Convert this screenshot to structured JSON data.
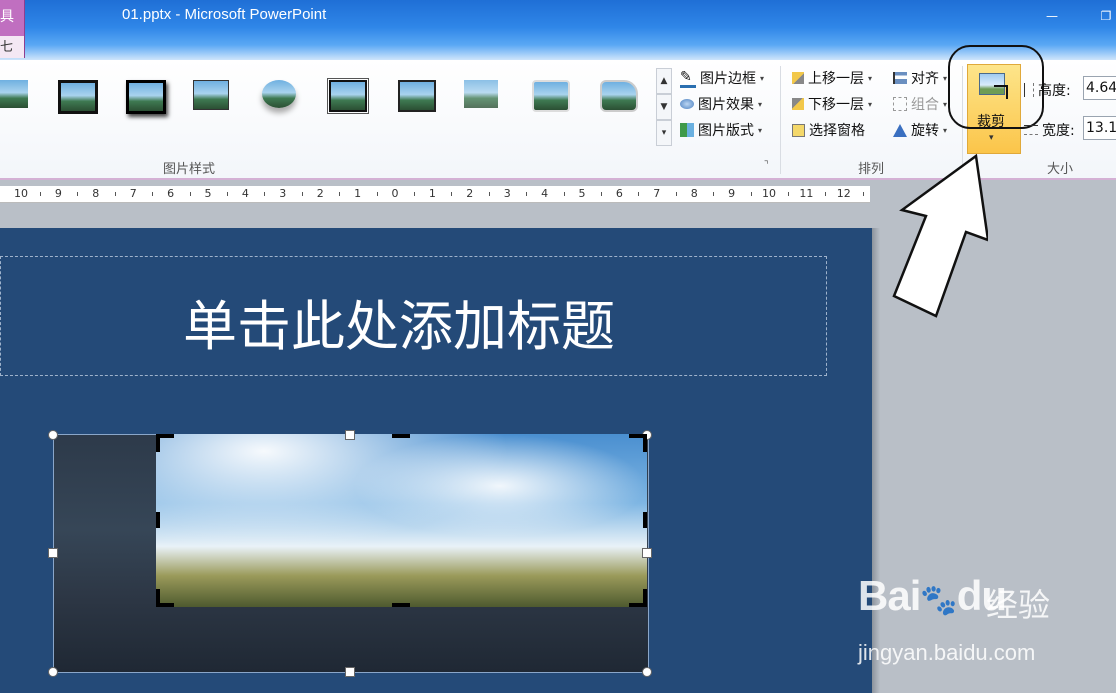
{
  "window": {
    "title": "01.pptx - Microsoft PowerPoint",
    "tool_tab_top": "具",
    "tool_tab_bottom": "七",
    "minimize": "—",
    "restore": "❐"
  },
  "ribbon": {
    "picture_styles_label": "图片样式",
    "picture_border": "图片边框",
    "picture_effects": "图片效果",
    "picture_layout": "图片版式",
    "arrange_label": "排列",
    "bring_forward": "上移一层",
    "send_backward": "下移一层",
    "selection_pane": "选择窗格",
    "align": "对齐",
    "group": "组合",
    "rotate": "旋转",
    "crop": "裁剪",
    "size_label": "大小",
    "height_label": "高度:",
    "height_value": "4.64",
    "width_label": "宽度:",
    "width_value": "13.1"
  },
  "ruler": {
    "numbers": [
      "10",
      "9",
      "8",
      "7",
      "6",
      "5",
      "4",
      "3",
      "2",
      "1",
      "0",
      "1",
      "2",
      "3",
      "4",
      "5",
      "6",
      "7",
      "8",
      "9",
      "10",
      "11",
      "12"
    ]
  },
  "slide": {
    "title": "单击此处添加标题"
  },
  "watermark": {
    "brand": "Bai",
    "brand2": "du",
    "cn": "经验",
    "url": "jingyan.baidu.com"
  },
  "colors": {
    "slide_bg": "#244a78",
    "accent": "#fbc54a",
    "tool_tab": "#c06fc0"
  }
}
